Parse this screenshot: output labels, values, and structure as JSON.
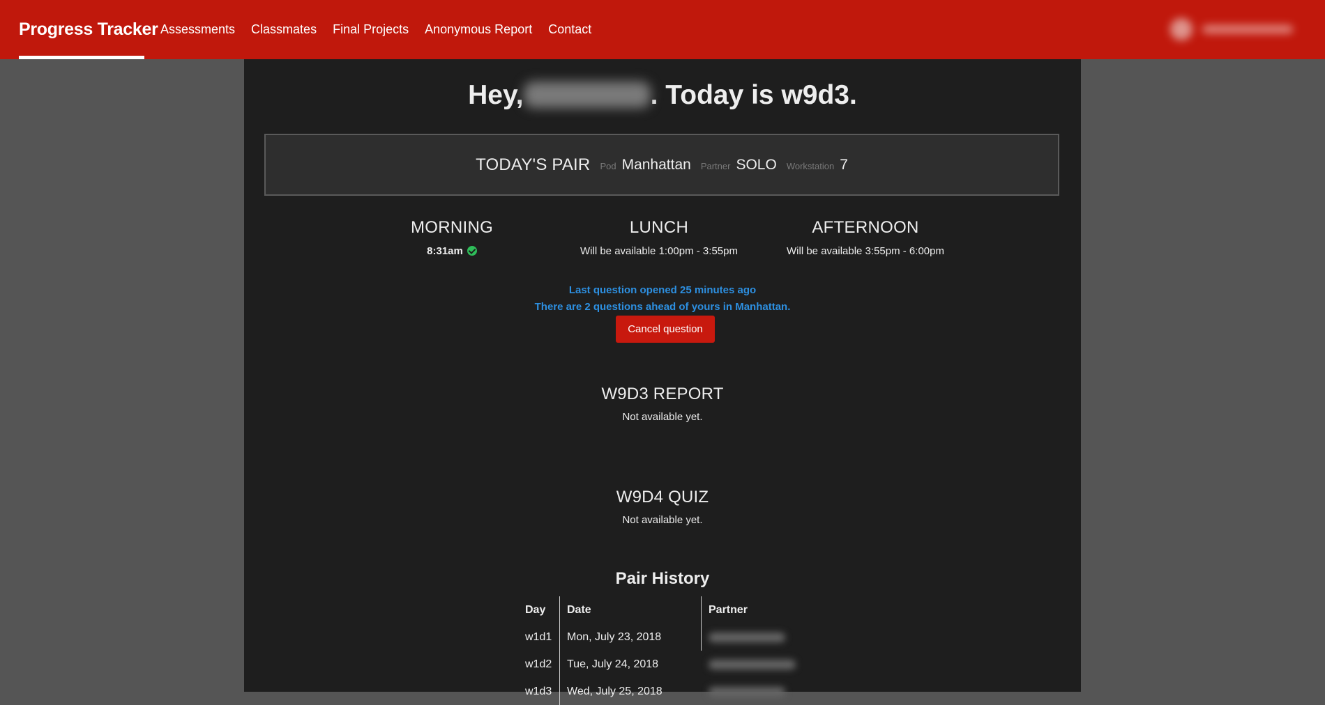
{
  "navbar": {
    "brand": "Progress Tracker",
    "links": [
      "Assessments",
      "Classmates",
      "Final Projects",
      "Anonymous Report",
      "Contact"
    ]
  },
  "greeting": {
    "prefix": "Hey,",
    "suffix": ". Today is w9d3."
  },
  "pair": {
    "title": "TODAY'S PAIR",
    "pod_label": "Pod",
    "pod_value": "Manhattan",
    "partner_label": "Partner",
    "partner_value": "SOLO",
    "workstation_label": "Workstation",
    "workstation_value": "7"
  },
  "sessions": {
    "morning": {
      "title": "MORNING",
      "time": "8:31am"
    },
    "lunch": {
      "title": "LUNCH",
      "note": "Will be available 1:00pm - 3:55pm"
    },
    "afternoon": {
      "title": "AFTERNOON",
      "note": "Will be available 3:55pm - 6:00pm"
    }
  },
  "queue": {
    "line1": "Last question opened 25 minutes ago",
    "line2": "There are 2 questions ahead of yours in Manhattan.",
    "cancel_label": "Cancel question"
  },
  "report": {
    "title": "W9D3 REPORT",
    "status": "Not available yet."
  },
  "quiz": {
    "title": "W9D4 QUIZ",
    "status": "Not available yet."
  },
  "history": {
    "title": "Pair History",
    "headers": {
      "day": "Day",
      "date": "Date",
      "partner": "Partner"
    },
    "rows": [
      {
        "day": "w1d1",
        "date": "Mon, July 23, 2018"
      },
      {
        "day": "w1d2",
        "date": "Tue, July 24, 2018"
      },
      {
        "day": "w1d3",
        "date": "Wed, July 25, 2018"
      }
    ]
  }
}
